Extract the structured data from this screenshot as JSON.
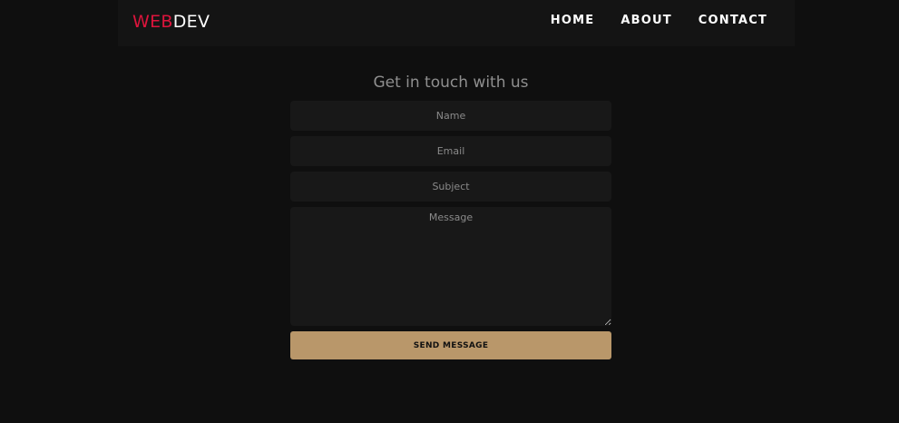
{
  "header": {
    "logo_part1": "WEB",
    "logo_part2": "DEV",
    "logo_part1_color": "#dc143c",
    "nav": [
      {
        "label": "HOME"
      },
      {
        "label": "ABOUT"
      },
      {
        "label": "CONTACT"
      }
    ]
  },
  "contact_form": {
    "title": "Get in touch with us",
    "name_placeholder": "Name",
    "email_placeholder": "Email",
    "subject_placeholder": "Subject",
    "message_placeholder": "Message",
    "submit_label": "SEND MESSAGE",
    "button_color": "#b9976a"
  }
}
